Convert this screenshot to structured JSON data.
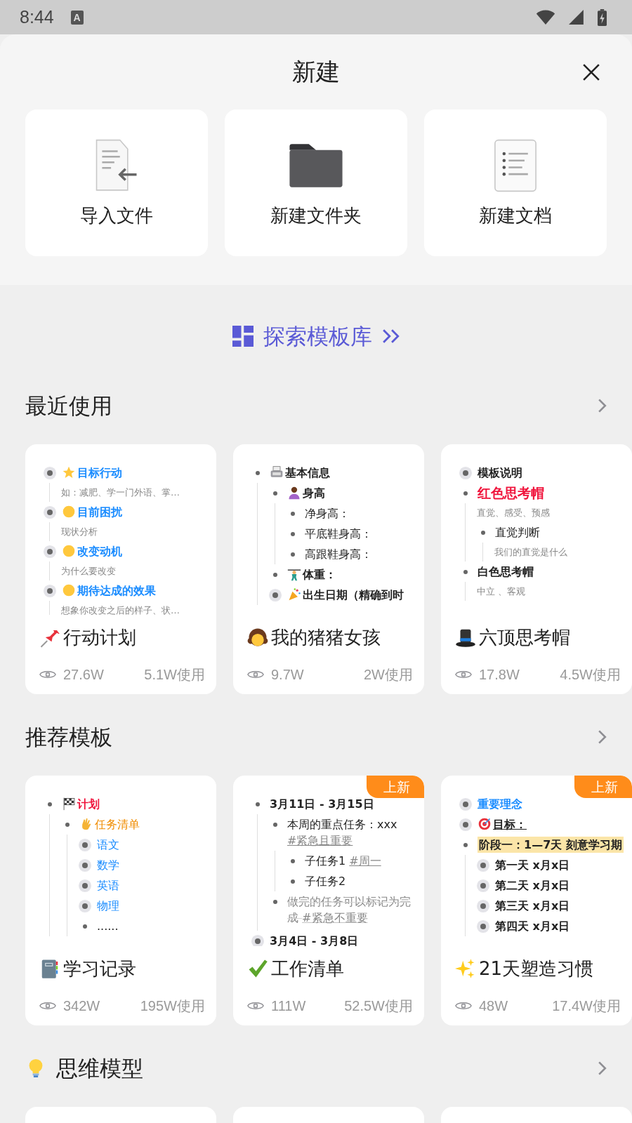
{
  "status_bar": {
    "time": "8:44",
    "notification": "A"
  },
  "sheet": {
    "title": "新建",
    "actions": [
      {
        "label": "导入文件"
      },
      {
        "label": "新建文件夹"
      },
      {
        "label": "新建文档"
      }
    ]
  },
  "explore": {
    "label": "探索模板库"
  },
  "sections": [
    {
      "title": "最近使用",
      "cards": [
        {
          "kind": "template",
          "title": "行动计划",
          "views": "27.6W",
          "uses": "5.1W使用",
          "preview": [
            {
              "text": "目标行动",
              "kind": "heading",
              "collapsed": true,
              "color": "#1a8cff",
              "note": "如：减肥、学一门外语、掌…"
            },
            {
              "text": "目前困扰",
              "kind": "heading",
              "collapsed": true,
              "color": "#1a8cff",
              "note": "现状分析"
            },
            {
              "text": "改变动机",
              "kind": "heading",
              "collapsed": true,
              "color": "#1a8cff",
              "note": "为什么要改变"
            },
            {
              "text": "期待达成的效果",
              "kind": "heading",
              "collapsed": true,
              "color": "#1a8cff",
              "note": "想象你改变之后的样子、状…"
            }
          ]
        },
        {
          "kind": "template",
          "title": "我的猪猪女孩",
          "views": "9.7W",
          "uses": "2W使用",
          "preview": [
            {
              "text": "基本信息",
              "kind": "heading",
              "collapsed": false,
              "children": [
                {
                  "text": "身高",
                  "kind": "heading",
                  "collapsed": false,
                  "children": [
                    {
                      "text": "净身高：",
                      "kind": "item",
                      "collapsed": false
                    },
                    {
                      "text": "平底鞋身高：",
                      "kind": "item",
                      "collapsed": false
                    },
                    {
                      "text": "高跟鞋身高：",
                      "kind": "item",
                      "collapsed": false
                    }
                  ]
                },
                {
                  "text": "体重：",
                  "kind": "heading",
                  "collapsed": false
                },
                {
                  "text": "出生日期（精确到时",
                  "kind": "heading",
                  "collapsed": true
                }
              ]
            }
          ]
        },
        {
          "kind": "template",
          "title": "六顶思考帽",
          "views": "17.8W",
          "uses": "4.5W使用",
          "preview": [
            {
              "text": "模板说明",
              "kind": "heading",
              "collapsed": true
            },
            {
              "text": "红色思考帽",
              "kind": "title",
              "collapsed": false,
              "color": "#f0143c",
              "note": "直觉、感受、预感",
              "children": [
                {
                  "text": "直觉判断",
                  "kind": "item",
                  "collapsed": false,
                  "note": "我们的直觉是什么"
                }
              ]
            },
            {
              "text": "白色思考帽",
              "kind": "heading",
              "collapsed": false,
              "note": "中立 、客观"
            }
          ]
        }
      ]
    },
    {
      "title": "推荐模板",
      "cards": [
        {
          "kind": "template",
          "title": "学习记录",
          "views": "342W",
          "uses": "195W使用",
          "preview": [
            {
              "text": "计划",
              "kind": "heading",
              "collapsed": false,
              "color": "#f0143c",
              "children": [
                {
                  "text": "任务清单",
                  "kind": "item",
                  "collapsed": false,
                  "color": "#f08c00",
                  "children": [
                    {
                      "text": "语文",
                      "kind": "item",
                      "collapsed": true,
                      "color": "#1a8cff"
                    },
                    {
                      "text": "数学",
                      "kind": "item",
                      "collapsed": true,
                      "color": "#1a8cff"
                    },
                    {
                      "text": "英语",
                      "kind": "item",
                      "collapsed": true,
                      "color": "#1a8cff"
                    },
                    {
                      "text": "物理",
                      "kind": "item",
                      "collapsed": true,
                      "color": "#1a8cff"
                    },
                    {
                      "text": "......",
                      "kind": "item",
                      "collapsed": false
                    }
                  ]
                }
              ]
            }
          ]
        },
        {
          "kind": "template",
          "title": "工作清单",
          "views": "111W",
          "uses": "52.5W使用",
          "badge": "上新",
          "preview": [
            {
              "text": "3月11日 - 3月15日",
              "kind": "heading",
              "collapsed": false,
              "children": [
                {
                  "text": "本周的重点任务：xxx",
                  "tag": "#紧急且重要",
                  "kind": "item",
                  "collapsed": false,
                  "children": [
                    {
                      "text": "子任务1",
                      "tag": "#周一",
                      "kind": "item",
                      "collapsed": false
                    },
                    {
                      "text": "子任务2",
                      "kind": "item",
                      "collapsed": false
                    }
                  ]
                },
                {
                  "text": "做完的任务可以标记为完成",
                  "tag": "#紧急不重要",
                  "kind": "struck",
                  "collapsed": false
                }
              ]
            },
            {
              "text": "3月4日 - 3月8日",
              "kind": "heading",
              "collapsed": true
            }
          ]
        },
        {
          "kind": "template",
          "title": "21天塑造习惯",
          "views": "48W",
          "uses": "17.4W使用",
          "badge": "上新",
          "preview": [
            {
              "text": "重要理念",
              "kind": "heading",
              "collapsed": true,
              "color": "#1a8cff"
            },
            {
              "text": "目标：",
              "kind": "underlined",
              "collapsed": true
            },
            {
              "text": "阶段一：1—7天 刻意学习期",
              "kind": "highlighted",
              "collapsed": false,
              "children": [
                {
                  "text": "第一天  x月x日",
                  "kind": "heading",
                  "collapsed": true
                },
                {
                  "text": "第二天  x月x日",
                  "kind": "heading",
                  "collapsed": true
                },
                {
                  "text": "第三天  x月x日",
                  "kind": "heading",
                  "collapsed": true
                },
                {
                  "text": "第四天  x月x日",
                  "kind": "heading",
                  "collapsed": true
                }
              ]
            }
          ]
        }
      ]
    },
    {
      "title": "思维模型",
      "cards": [
        {
          "kind": "blank"
        },
        {
          "kind": "blank"
        },
        {
          "kind": "blank"
        }
      ]
    }
  ]
}
